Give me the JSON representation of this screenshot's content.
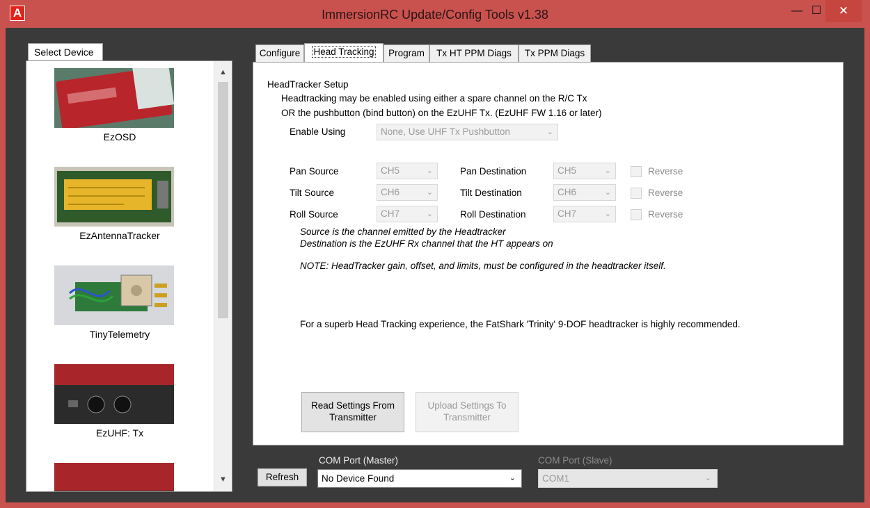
{
  "window": {
    "title": "ImmersionRC Update/Config Tools v1.38",
    "app_icon_letter": "A",
    "min_glyph": "—",
    "max_glyph": "☐",
    "close_glyph": "✕"
  },
  "device_panel": {
    "tab_label": "Select Device",
    "devices": [
      {
        "name": "EzOSD"
      },
      {
        "name": "EzAntennaTracker"
      },
      {
        "name": "TinyTelemetry"
      },
      {
        "name": "EzUHF: Tx"
      },
      {
        "name": ""
      }
    ],
    "scroll_up_glyph": "▲",
    "scroll_down_glyph": "▼"
  },
  "tabs": [
    "Configure",
    "Head Tracking",
    "Program",
    "Tx HT PPM Diags",
    "Tx PPM Diags"
  ],
  "active_tab": "Head Tracking",
  "head_tracking": {
    "section_title": "HeadTracker Setup",
    "desc_line1": "Headtracking may be enabled using either a spare channel on the R/C Tx",
    "desc_line2": "OR the pushbutton (bind button) on the EzUHF Tx. (EzUHF FW 1.16 or later)",
    "enable_label": "Enable Using",
    "enable_value": "None, Use UHF Tx Pushbutton",
    "rows": [
      {
        "source_label": "Pan Source",
        "source_value": "CH5",
        "dest_label": "Pan Destination",
        "dest_value": "CH5",
        "reverse_label": "Reverse",
        "reverse_checked": false
      },
      {
        "source_label": "Tilt Source",
        "source_value": "CH6",
        "dest_label": "Tilt Destination",
        "dest_value": "CH6",
        "reverse_label": "Reverse",
        "reverse_checked": false
      },
      {
        "source_label": "Roll Source",
        "source_value": "CH7",
        "dest_label": "Roll Destination",
        "dest_value": "CH7",
        "reverse_label": "Reverse",
        "reverse_checked": false
      }
    ],
    "note_source": "Source is the channel emitted by the Headtracker",
    "note_dest": "Destination is the EzUHF Rx channel that the HT appears on",
    "note_gain": "NOTE: HeadTracker gain, offset, and limits, must be configured in the headtracker itself.",
    "recommendation": "For a superb Head Tracking experience, the FatShark 'Trinity' 9-DOF headtracker is highly recommended.",
    "read_button": "Read Settings From Transmitter",
    "upload_button": "Upload Settings To Transmitter"
  },
  "bottom_bar": {
    "refresh_label": "Refresh",
    "com_master_label": "COM Port (Master)",
    "com_master_value": "No Device Found",
    "com_slave_label": "COM Port (Slave)",
    "com_slave_value": "COM1"
  },
  "caret_glyph": "⌄",
  "colors": {
    "titlebar": "#c9524f",
    "close_button": "#c7453f",
    "client_bg": "#3a3a3a",
    "disabled_text": "#9a9a9a"
  }
}
